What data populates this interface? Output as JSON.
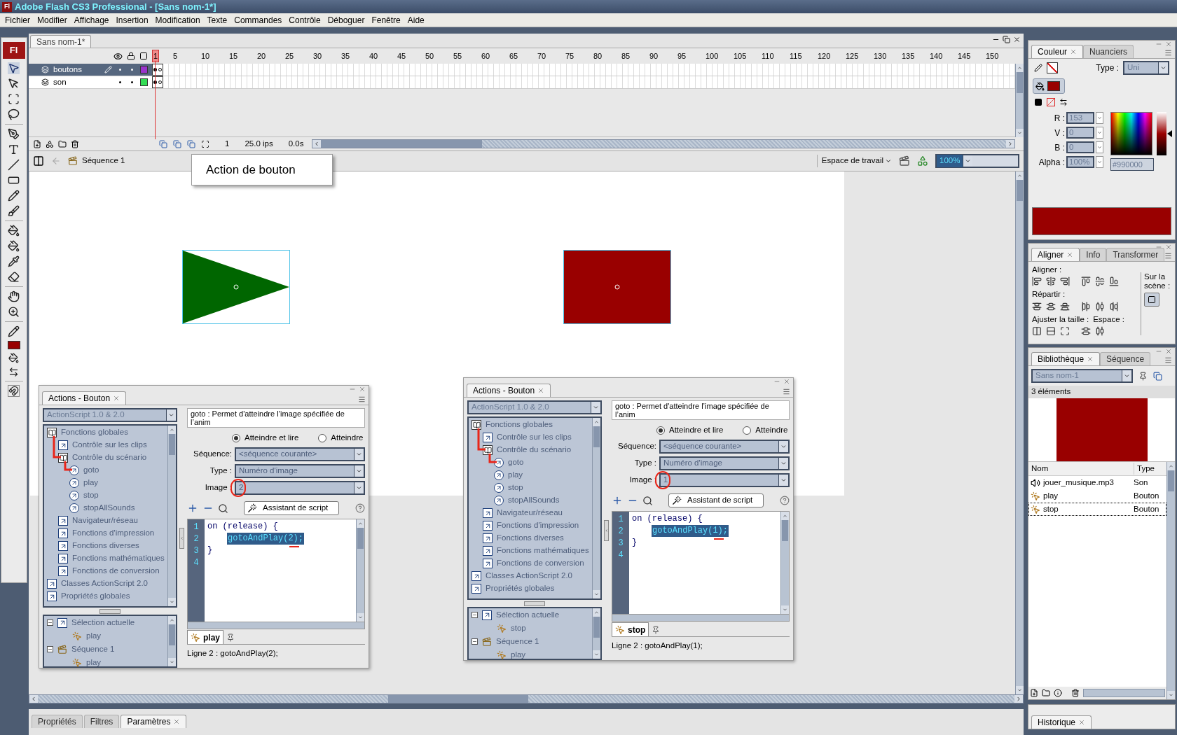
{
  "window": {
    "icon": "Fl",
    "title": "Adobe Flash CS3 Professional - [Sans nom-1*]"
  },
  "menu": [
    "Fichier",
    "Modifier",
    "Affichage",
    "Insertion",
    "Modification",
    "Texte",
    "Commandes",
    "Contrôle",
    "Déboguer",
    "Fenêtre",
    "Aide"
  ],
  "tools": {
    "logo": "Fl"
  },
  "document": {
    "tab": "Sans nom-1*"
  },
  "timeline": {
    "frames": [
      {
        "label": "1",
        "current": true
      },
      {
        "label": "5",
        "current": false
      },
      {
        "label": "10",
        "current": false
      },
      {
        "label": "15",
        "current": false
      },
      {
        "label": "20",
        "current": false
      },
      {
        "label": "25",
        "current": false
      },
      {
        "label": "30",
        "current": false
      },
      {
        "label": "35",
        "current": false
      },
      {
        "label": "40",
        "current": false
      },
      {
        "label": "45",
        "current": false
      },
      {
        "label": "50",
        "current": false
      },
      {
        "label": "55",
        "current": false
      },
      {
        "label": "60",
        "current": false
      },
      {
        "label": "65",
        "current": false
      },
      {
        "label": "70",
        "current": false
      },
      {
        "label": "75",
        "current": false
      },
      {
        "label": "80",
        "current": false
      },
      {
        "label": "85",
        "current": false
      },
      {
        "label": "90",
        "current": false
      },
      {
        "label": "95",
        "current": false
      },
      {
        "label": "100",
        "current": false
      },
      {
        "label": "105",
        "current": false
      },
      {
        "label": "110",
        "current": false
      },
      {
        "label": "115",
        "current": false
      },
      {
        "label": "120",
        "current": false
      },
      {
        "label": "125",
        "current": false
      },
      {
        "label": "130",
        "current": false
      },
      {
        "label": "135",
        "current": false
      },
      {
        "label": "140",
        "current": false
      },
      {
        "label": "145",
        "current": false
      },
      {
        "label": "150",
        "current": false
      }
    ],
    "layers": [
      {
        "name": "boutons",
        "selected": true,
        "color": "#9933cc"
      },
      {
        "name": "son",
        "selected": false,
        "color": "#33dd55"
      }
    ],
    "current_frame": "1",
    "frame_rate": "25.0 ips",
    "elapsed": "0.0s"
  },
  "edit_bar": {
    "scene": "Séquence 1",
    "workspace": "Espace de travail",
    "zoom": "100%"
  },
  "callout": "Action de bouton",
  "stage": {
    "shapes": [
      {
        "kind": "triangle",
        "color": "#006600"
      },
      {
        "kind": "rectangle",
        "color": "#990000"
      }
    ]
  },
  "action_panels": [
    {
      "tab": "Actions - Bouton",
      "version": "ActionScript 1.0 & 2.0",
      "help": "goto : Permet d'atteindre l’image spécifiée de l’anim",
      "radios": [
        {
          "label": "Atteindre et lire",
          "selected": true
        },
        {
          "label": "Atteindre",
          "selected": false
        }
      ],
      "fields": [
        {
          "label": "Séquence:",
          "value": "<séquence courante>"
        },
        {
          "label": "Type :",
          "value": "Numéro d'image"
        },
        {
          "label": "Image :",
          "value": "2"
        }
      ],
      "assistant": "Assistant de script",
      "toolbox": [
        {
          "label": "Fonctions globales",
          "kind": "category",
          "children": [
            {
              "label": "Contrôle sur les clips",
              "kind": "folder"
            },
            {
              "label": "Contrôle du scénario",
              "kind": "category",
              "children": [
                {
                  "label": "goto",
                  "kind": "action"
                },
                {
                  "label": "play",
                  "kind": "action"
                },
                {
                  "label": "stop",
                  "kind": "action"
                },
                {
                  "label": "stopAllSounds",
                  "kind": "action"
                }
              ]
            },
            {
              "label": "Navigateur/réseau",
              "kind": "folder"
            },
            {
              "label": "Fonctions d'impression",
              "kind": "folder"
            },
            {
              "label": "Fonctions diverses",
              "kind": "folder"
            },
            {
              "label": "Fonctions mathématiques",
              "kind": "folder"
            },
            {
              "label": "Fonctions de conversion",
              "kind": "folder"
            }
          ]
        },
        {
          "label": "Classes ActionScript 2.0",
          "kind": "folder"
        },
        {
          "label": "Propriétés globales",
          "kind": "folder"
        }
      ],
      "code": [
        {
          "number": "1",
          "text": "on (release) {",
          "indented": false,
          "selected": false
        },
        {
          "number": "2",
          "text": "gotoAndPlay(2);",
          "indented": true,
          "selected": true
        },
        {
          "number": "3",
          "text": "}",
          "indented": false,
          "selected": false
        },
        {
          "number": "4"
        }
      ],
      "selection": [
        {
          "label": "Sélection actuelle",
          "kind": "current",
          "children": [
            {
              "label": "play",
              "kind": "button"
            }
          ]
        },
        {
          "label": "Séquence 1",
          "kind": "scene",
          "children": [
            {
              "label": "play",
              "kind": "button"
            }
          ]
        }
      ],
      "pinned": "play",
      "status": "Ligne 2 : gotoAndPlay(2);"
    },
    {
      "tab": "Actions - Bouton",
      "version": "ActionScript 1.0 & 2.0",
      "help": "goto : Permet d'atteindre l’image spécifiée de l’anim",
      "radios": [
        {
          "label": "Atteindre et lire",
          "selected": true
        },
        {
          "label": "Atteindre",
          "selected": false
        }
      ],
      "fields": [
        {
          "label": "Séquence:",
          "value": "<séquence courante>"
        },
        {
          "label": "Type :",
          "value": "Numéro d'image"
        },
        {
          "label": "Image :",
          "value": "1"
        }
      ],
      "assistant": "Assistant de script",
      "toolbox": [
        {
          "label": "Fonctions globales",
          "kind": "category",
          "children": [
            {
              "label": "Contrôle sur les clips",
              "kind": "folder"
            },
            {
              "label": "Contrôle du scénario",
              "kind": "category",
              "children": [
                {
                  "label": "goto",
                  "kind": "action"
                },
                {
                  "label": "play",
                  "kind": "action"
                },
                {
                  "label": "stop",
                  "kind": "action"
                },
                {
                  "label": "stopAllSounds",
                  "kind": "action"
                }
              ]
            },
            {
              "label": "Navigateur/réseau",
              "kind": "folder"
            },
            {
              "label": "Fonctions d'impression",
              "kind": "folder"
            },
            {
              "label": "Fonctions diverses",
              "kind": "folder"
            },
            {
              "label": "Fonctions mathématiques",
              "kind": "folder"
            },
            {
              "label": "Fonctions de conversion",
              "kind": "folder"
            }
          ]
        },
        {
          "label": "Classes ActionScript 2.0",
          "kind": "folder"
        },
        {
          "label": "Propriétés globales",
          "kind": "folder"
        }
      ],
      "code": [
        {
          "number": "1",
          "text": "on (release) {",
          "indented": false,
          "selected": false
        },
        {
          "number": "2",
          "text": "gotoAndPlay(1);",
          "indented": true,
          "selected": true
        },
        {
          "number": "3",
          "text": "}",
          "indented": false,
          "selected": false
        },
        {
          "number": "4"
        }
      ],
      "selection": [
        {
          "label": "Sélection actuelle",
          "kind": "current",
          "children": [
            {
              "label": "stop",
              "kind": "button"
            }
          ]
        },
        {
          "label": "Séquence 1",
          "kind": "scene",
          "children": [
            {
              "label": "play",
              "kind": "button"
            }
          ]
        }
      ],
      "pinned": "stop",
      "status": "Ligne 2 : gotoAndPlay(1);"
    }
  ],
  "panel_tabs": [
    {
      "label": "Propriétés",
      "selected": false
    },
    {
      "label": "Filtres",
      "selected": false
    },
    {
      "label": "Paramètres",
      "selected": true
    }
  ],
  "color_panel": {
    "tabs": [
      {
        "label": "Couleur",
        "selected": true
      },
      {
        "label": "Nuanciers",
        "selected": false
      }
    ],
    "type_label": "Type :",
    "type": "Uni",
    "brightness": {
      "level": 0.5
    },
    "channels": [
      {
        "label": "R :",
        "value": "153"
      },
      {
        "label": "V :",
        "value": "0"
      },
      {
        "label": "B :",
        "value": "0"
      },
      {
        "label": "Alpha :",
        "value": "100%"
      }
    ],
    "hex": "#990000"
  },
  "align_panel": {
    "tabs": [
      {
        "label": "Aligner",
        "selected": true
      },
      {
        "label": "Info",
        "selected": false
      },
      {
        "label": "Transformer",
        "selected": false
      }
    ],
    "align_label": "Aligner :",
    "distribute_label": "Répartir :",
    "match_size_label": "Ajuster la taille :",
    "space_label": "Espace :",
    "to_stage_label": "Sur la scène :"
  },
  "library": {
    "tabs": [
      {
        "label": "Bibliothèque",
        "selected": true
      },
      {
        "label": "Séquence",
        "selected": false
      }
    ],
    "document": "Sans nom-1",
    "count": "3 éléments",
    "columns": [
      "Nom",
      "Type"
    ],
    "items": [
      {
        "name": "jouer_musique.mp3",
        "type": "Son",
        "kind": "sound",
        "selected": false
      },
      {
        "name": "play",
        "type": "Bouton",
        "kind": "button",
        "selected": false
      },
      {
        "name": "stop",
        "type": "Bouton",
        "kind": "button",
        "selected": true
      }
    ]
  },
  "history": {
    "tab": "Historique"
  }
}
